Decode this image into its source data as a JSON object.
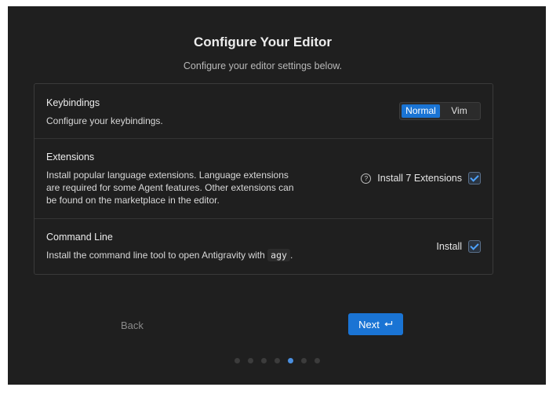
{
  "header": {
    "title": "Configure Your Editor",
    "subtitle": "Configure your editor settings below."
  },
  "sections": {
    "keybindings": {
      "title": "Keybindings",
      "description": "Configure your keybindings.",
      "options": [
        "Normal",
        "Vim"
      ],
      "selected": "Normal"
    },
    "extensions": {
      "title": "Extensions",
      "description_lines": [
        "Install popular language extensions. Language extensions",
        "are required for some Agent features. Other extensions can",
        "be found on the marketplace in the editor."
      ],
      "checkbox_label": "Install 7 Extensions",
      "checked": true
    },
    "command_line": {
      "title": "Command Line",
      "description_prefix": "Install the command line tool to open Antigravity with",
      "command": "agy",
      "description_suffix": ".",
      "checkbox_label": "Install",
      "checked": true
    }
  },
  "footer": {
    "back_label": "Back",
    "next_label": "Next",
    "next_icon": "enter-icon",
    "steps_total": 7,
    "current_step": 5
  },
  "colors": {
    "background": "#1f1f1f",
    "accent": "#1a74d4",
    "active_dot": "#4a8fe0"
  }
}
